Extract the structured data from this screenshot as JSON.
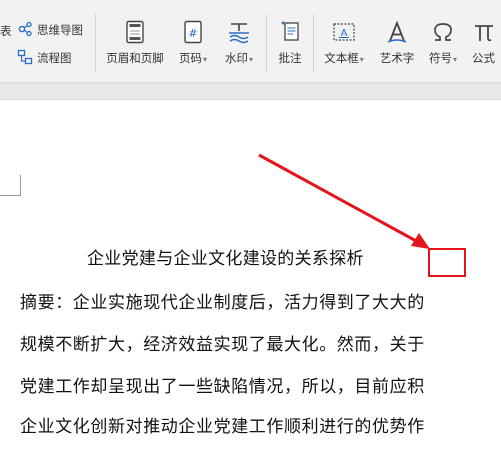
{
  "ribbon": {
    "left_cut_label": "表",
    "mindmap_label": "思维导图",
    "flowchart_label": "流程图",
    "header_footer_label": "页眉和页脚",
    "page_number_label": "页码",
    "watermark_label": "水印",
    "comment_label": "批注",
    "textbox_label": "文本框",
    "wordart_label": "艺术字",
    "symbol_label": "符号",
    "formula_label": "公式",
    "caret": "▾"
  },
  "document": {
    "title": "企业党建与企业文化建设的关系探析",
    "lines": [
      "摘要：企业实施现代企业制度后，活力得到了大大的",
      "规模不断扩大，经济效益实现了最大化。然而，关于",
      "党建工作却呈现出了一些缺陷情况，所以，目前应积",
      "企业文化创新对推动企业党建工作顺利进行的优势作"
    ]
  },
  "annotation": {
    "color": "#e3141b"
  }
}
